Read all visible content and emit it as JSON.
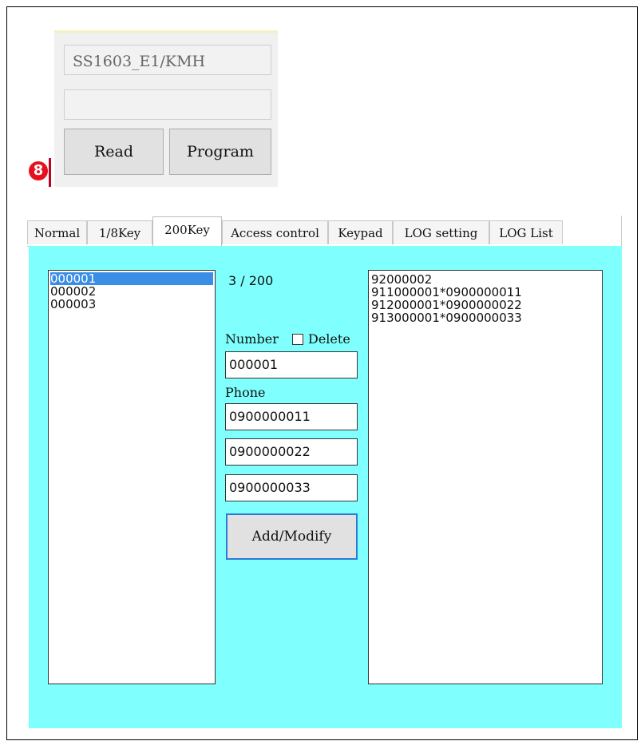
{
  "device": {
    "model_value": "SS1603_E1/KMH",
    "second_value": "",
    "read_label": "Read",
    "program_label": "Program",
    "step_badge": "8"
  },
  "tabs": [
    {
      "label": "Normal"
    },
    {
      "label": "1/8Key"
    },
    {
      "label": "200Key",
      "active": true
    },
    {
      "label": "Access control"
    },
    {
      "label": "Keypad"
    },
    {
      "label": "LOG setting"
    },
    {
      "label": "LOG List"
    }
  ],
  "key200": {
    "entries": [
      "000001",
      "000002",
      "000003"
    ],
    "selected_index": 0,
    "count": "3 / 200",
    "number_label": "Number",
    "delete_label": "Delete",
    "delete_checked": false,
    "number_value": "000001",
    "phone_label": "Phone",
    "phones": [
      "0900000011",
      "0900000022",
      "0900000033"
    ],
    "add_label": "Add/Modify",
    "output_lines": [
      "92000002",
      "911000001*0900000011",
      "912000001*0900000022",
      "913000001*0900000033"
    ]
  },
  "colors": {
    "content_bg": "#80ffff",
    "selection": "#3a8ee6",
    "badge": "#e8101f"
  }
}
